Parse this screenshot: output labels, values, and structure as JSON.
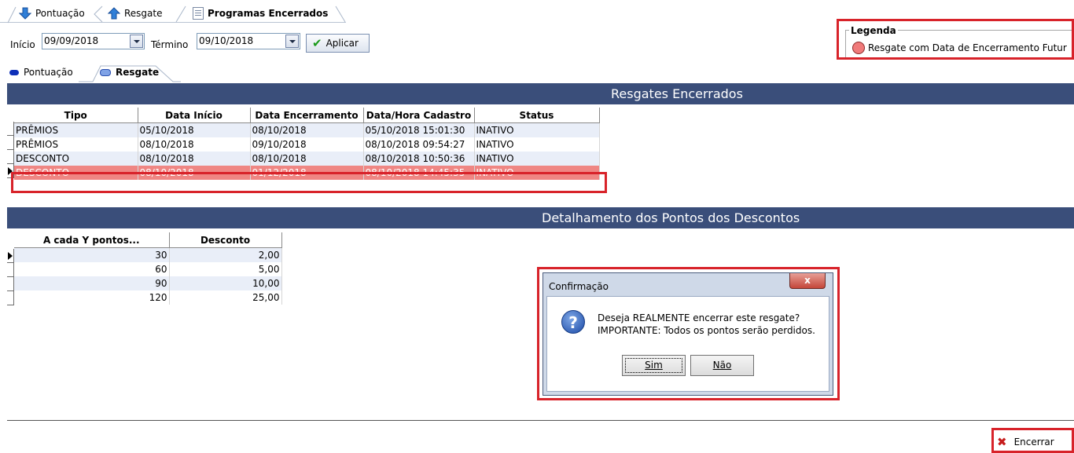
{
  "top_tabs": [
    {
      "label": "Pontuação"
    },
    {
      "label": "Resgate"
    },
    {
      "label": "Programas Encerrados"
    }
  ],
  "filter": {
    "inicio_label": "Início",
    "inicio_value": "09/09/2018",
    "termino_label": "Término",
    "termino_value": "09/10/2018",
    "aplicar_label": "Aplicar"
  },
  "legend": {
    "title": "Legenda",
    "item": "Resgate com Data de Encerramento Futur",
    "dot_color": "#f07a7a"
  },
  "sub_tabs": [
    {
      "label": "Pontuação"
    },
    {
      "label": "Resgate"
    }
  ],
  "resgates": {
    "title": "Resgates Encerrados",
    "columns": [
      "Tipo",
      "Data Início",
      "Data Encerramento",
      "Data/Hora Cadastro",
      "Status"
    ],
    "rows": [
      [
        "PRÊMIOS",
        "05/10/2018",
        "08/10/2018",
        "05/10/2018 15:01:30",
        "INATIVO"
      ],
      [
        "PRÊMIOS",
        "08/10/2018",
        "09/10/2018",
        "08/10/2018 09:54:27",
        "INATIVO"
      ],
      [
        "DESCONTO",
        "08/10/2018",
        "08/10/2018",
        "08/10/2018 10:50:36",
        "INATIVO"
      ],
      [
        "DESCONTO",
        "08/10/2018",
        "01/12/2018",
        "08/10/2018 14:45:35",
        "INATIVO"
      ]
    ]
  },
  "detalhamento": {
    "title": "Detalhamento dos Pontos dos Descontos",
    "columns": [
      "A cada Y pontos...",
      "Desconto"
    ],
    "rows": [
      [
        "30",
        "2,00"
      ],
      [
        "60",
        "5,00"
      ],
      [
        "90",
        "10,00"
      ],
      [
        "120",
        "25,00"
      ]
    ]
  },
  "dialog": {
    "title": "Confirmação",
    "close": "x",
    "icon": "question-icon",
    "line1": "Deseja REALMENTE encerrar este resgate?",
    "line2": "IMPORTANTE: Todos os pontos serão perdidos.",
    "yes": "Sim",
    "no": "Não"
  },
  "footer": {
    "encerrar_label": "Encerrar"
  },
  "colors": {
    "header_bg": "#3a4e7a",
    "highlight_row": "#ef8683",
    "annotation_red": "#d8232a"
  }
}
